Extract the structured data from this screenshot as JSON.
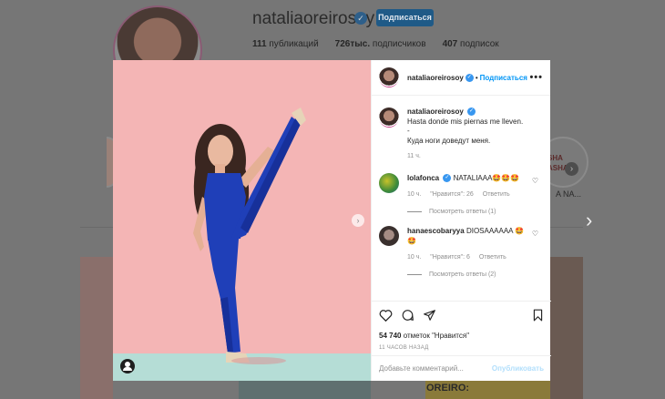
{
  "profile": {
    "username": "nataliaoreirosoy",
    "verified_glyph": "✓",
    "follow_label": "Подписаться",
    "stats": {
      "posts": "111",
      "posts_label": "публикаций",
      "followers": "726тыс.",
      "followers_label": "подписчиков",
      "following": "407",
      "following_label": "подписок"
    },
    "highlight_text_line1": "SHA",
    "highlight_text_line2": "ASHA",
    "highlight_label": "A NA...",
    "magazine_text": "OREIRO:"
  },
  "post": {
    "header": {
      "username": "nataliaoreirosoy",
      "separator": "•",
      "follow_label": "Подписаться",
      "more_label": "•••"
    },
    "caption": {
      "username": "nataliaoreirosoy",
      "lines": [
        "Hasta donde mis piernas me lleven.",
        "-",
        "Куда ноги доведут меня."
      ],
      "time": "11 ч."
    },
    "comments": [
      {
        "username": "lolafonca",
        "text": "NATALIAAA🤩🤩🤩",
        "time": "10 ч.",
        "likes": "\"Нравится\": 26",
        "reply_label": "Ответить",
        "replies_label": "Посмотреть ответы (1)"
      },
      {
        "username": "hanaescobaryya",
        "text": "DIOSAAAAAA 🤩🤩",
        "time": "10 ч.",
        "likes": "\"Нравится\": 6",
        "reply_label": "Ответить",
        "replies_label": "Посмотреть ответы (2)"
      }
    ],
    "likes_count": "54 740",
    "likes_label": "отметок \"Нравится\"",
    "posted_time": "11 часов назад",
    "add_comment_placeholder": "Добавьте комментарий...",
    "publish_label": "Опубликовать",
    "icons": [
      "heart-icon",
      "comment-icon",
      "share-icon",
      "save-icon",
      "tag-user-icon",
      "next-arrow-icon"
    ]
  },
  "colors": {
    "accent": "#0095f6",
    "photo_background": "#f4b5b5",
    "jumpsuit": "#1f3fb8",
    "overlay": "#767676"
  }
}
